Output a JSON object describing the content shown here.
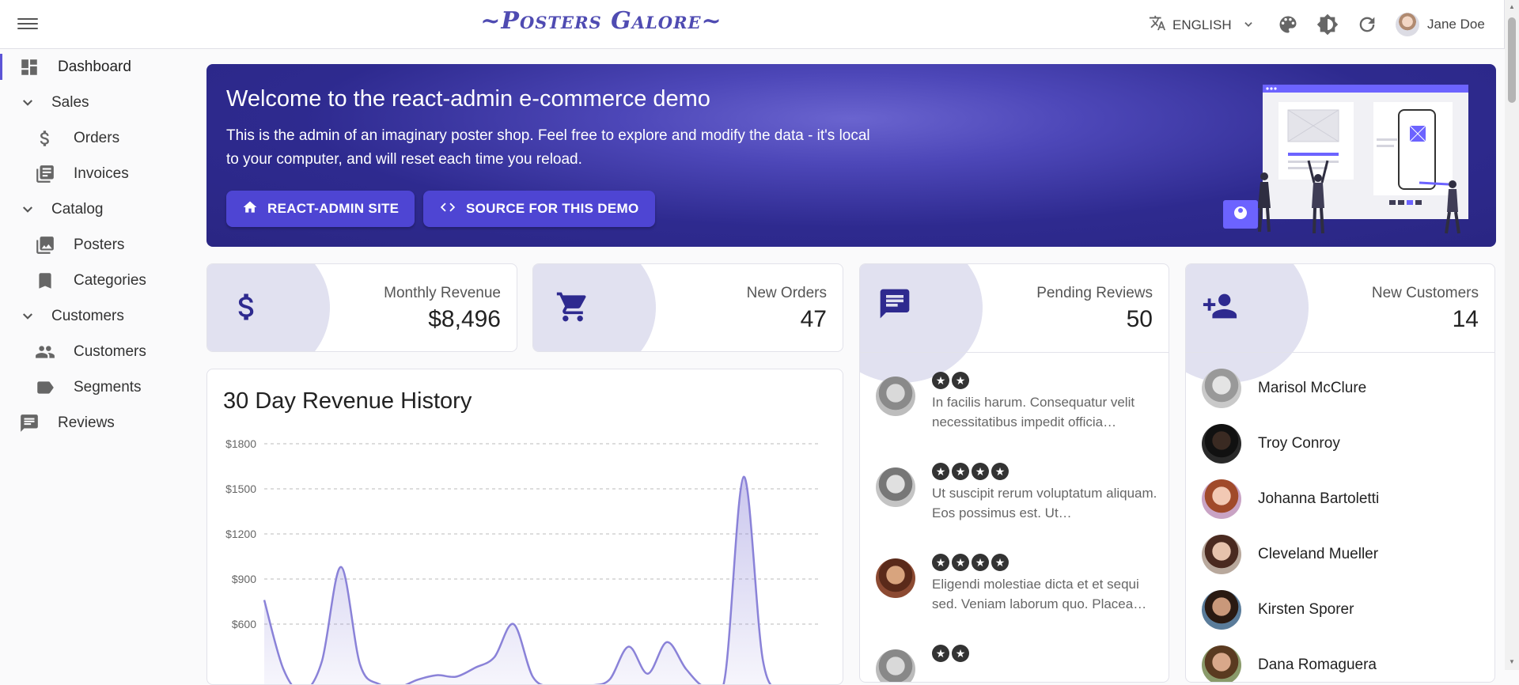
{
  "header": {
    "app_title": "~Posters Galore~",
    "language": "ENGLISH",
    "user_name": "Jane Doe"
  },
  "sidebar": {
    "items": [
      {
        "label": "Dashboard",
        "icon": "dashboard-icon"
      },
      {
        "label": "Sales",
        "icon": "chevron-down-icon"
      },
      {
        "label": "Orders",
        "icon": "dollar-icon"
      },
      {
        "label": "Invoices",
        "icon": "library-books-icon"
      },
      {
        "label": "Catalog",
        "icon": "chevron-down-icon"
      },
      {
        "label": "Posters",
        "icon": "collections-icon"
      },
      {
        "label": "Categories",
        "icon": "bookmark-icon"
      },
      {
        "label": "Customers",
        "icon": "chevron-down-icon"
      },
      {
        "label": "Customers",
        "icon": "people-icon"
      },
      {
        "label": "Segments",
        "icon": "label-icon"
      },
      {
        "label": "Reviews",
        "icon": "comment-icon"
      }
    ]
  },
  "banner": {
    "title": "Welcome to the react-admin e-commerce demo",
    "text": "This is the admin of an imaginary poster shop. Feel free to explore and modify the data - it's local to your computer, and will reset each time you reload.",
    "button1": "REACT-ADMIN SITE",
    "button2": "SOURCE FOR THIS DEMO"
  },
  "stats": {
    "monthly_revenue": {
      "label": "Monthly Revenue",
      "value": "$8,496"
    },
    "new_orders": {
      "label": "New Orders",
      "value": "47"
    },
    "pending_reviews": {
      "label": "Pending Reviews",
      "value": "50"
    },
    "new_customers": {
      "label": "New Customers",
      "value": "14"
    }
  },
  "reviews": [
    {
      "rating": 2,
      "text": "In facilis harum. Consequatur velit necessitatibus impedit officia…"
    },
    {
      "rating": 4,
      "text": "Ut suscipit rerum voluptatum aliquam. Eos possimus est. Ut…"
    },
    {
      "rating": 4,
      "text": "Eligendi molestiae dicta et et sequi sed. Veniam laborum quo. Placea…"
    },
    {
      "rating": 2,
      "text": ""
    }
  ],
  "customers": [
    {
      "name": "Marisol McClure"
    },
    {
      "name": "Troy Conroy"
    },
    {
      "name": "Johanna Bartoletti"
    },
    {
      "name": "Cleveland Mueller"
    },
    {
      "name": "Kirsten Sporer"
    },
    {
      "name": "Dana Romaguera"
    }
  ],
  "colors": {
    "primary": "#4f4bb2",
    "banner_dark": "#2e2a8f",
    "accent_button": "#4e45d3",
    "chart_line": "#8a82d8"
  },
  "chart_data": {
    "type": "area",
    "title": "30 Day Revenue History",
    "y_ticks": [
      "$1800",
      "$1500",
      "$1200",
      "$900",
      "$600"
    ],
    "ylim": [
      0,
      1950
    ],
    "grid": true,
    "x": [
      0,
      1,
      2,
      3,
      4,
      5,
      6,
      7,
      8,
      9,
      10,
      11,
      12,
      13,
      14,
      15,
      16,
      17,
      18,
      19,
      20,
      21,
      22,
      23,
      24,
      25,
      26,
      27,
      28,
      29
    ],
    "values": [
      760,
      300,
      150,
      350,
      980,
      330,
      200,
      180,
      230,
      260,
      250,
      310,
      380,
      600,
      250,
      180,
      160,
      190,
      230,
      450,
      270,
      480,
      300,
      180,
      230,
      1580,
      360,
      160,
      140,
      140
    ]
  }
}
